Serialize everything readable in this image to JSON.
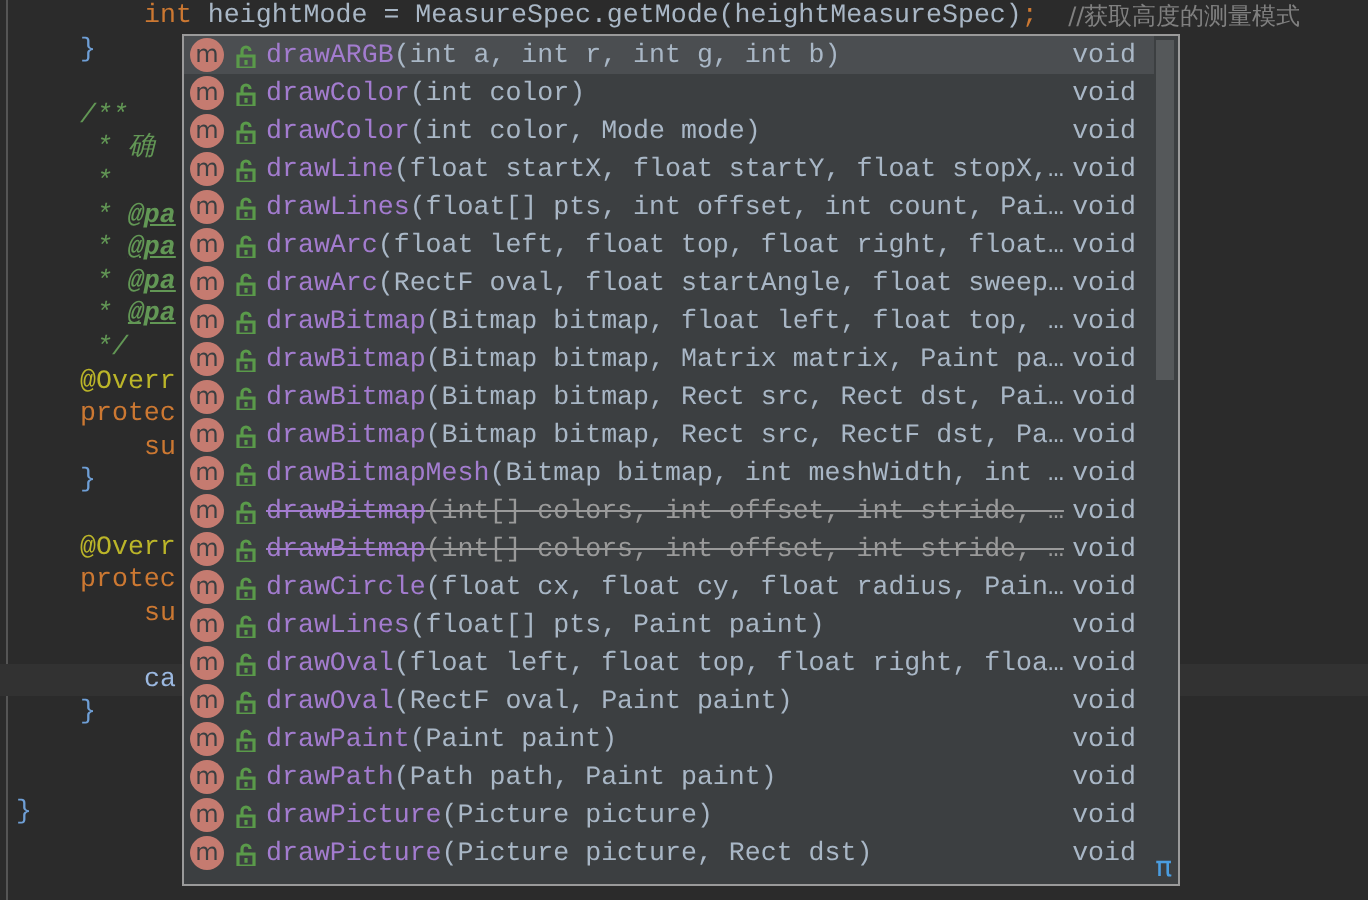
{
  "editor": {
    "lines": [
      {
        "kind": "block",
        "children": [
          {
            "kind": "block",
            "children": [
              {
                "kind": "code",
                "current": false,
                "segments": [
                  {
                    "text": "int",
                    "kind": "keyword"
                  },
                  {
                    "text": " heightMode = MeasureSpec.getMode(heightMeasureSpec)",
                    "kind": "plain"
                  },
                  {
                    "text": ";",
                    "kind": "keyword"
                  },
                  {
                    "text": "    //获取高度的测量模式",
                    "kind": "comment"
                  }
                ]
              }
            ]
          },
          {
            "kind": "code",
            "current": false,
            "segments": [
              {
                "text": "}",
                "kind": "brace"
              }
            ]
          },
          {
            "kind": "blank",
            "current": false
          },
          {
            "kind": "code",
            "current": false,
            "segments": [
              {
                "text": "/**",
                "kind": "doc"
              }
            ]
          },
          {
            "kind": "code",
            "current": false,
            "segments": [
              {
                "text": " * 确",
                "kind": "doc"
              }
            ]
          },
          {
            "kind": "code",
            "current": false,
            "segments": [
              {
                "text": " *",
                "kind": "doc"
              }
            ]
          },
          {
            "kind": "code",
            "current": false,
            "segments": [
              {
                "text": " * ",
                "kind": "doc"
              },
              {
                "text": "@pa",
                "kind": "doctag"
              }
            ]
          },
          {
            "kind": "code",
            "current": false,
            "segments": [
              {
                "text": " * ",
                "kind": "doc"
              },
              {
                "text": "@pa",
                "kind": "doctag"
              }
            ]
          },
          {
            "kind": "code",
            "current": false,
            "segments": [
              {
                "text": " * ",
                "kind": "doc"
              },
              {
                "text": "@pa",
                "kind": "doctag"
              }
            ]
          },
          {
            "kind": "code",
            "current": false,
            "segments": [
              {
                "text": " * ",
                "kind": "doc"
              },
              {
                "text": "@pa",
                "kind": "doctag"
              }
            ]
          },
          {
            "kind": "code",
            "current": false,
            "segments": [
              {
                "text": " */",
                "kind": "doc"
              }
            ]
          },
          {
            "kind": "code",
            "current": false,
            "segments": [
              {
                "text": "@Overr",
                "kind": "annotation"
              }
            ]
          },
          {
            "kind": "code",
            "current": false,
            "segments": [
              {
                "text": "protec",
                "kind": "keyword"
              }
            ]
          },
          {
            "kind": "block",
            "children": [
              {
                "kind": "code",
                "current": false,
                "segments": [
                  {
                    "text": "su",
                    "kind": "keyword"
                  }
                ]
              }
            ]
          },
          {
            "kind": "code",
            "current": false,
            "segments": [
              {
                "text": "}",
                "kind": "brace"
              }
            ]
          },
          {
            "kind": "blank",
            "current": false
          },
          {
            "kind": "code",
            "current": false,
            "segments": [
              {
                "text": "@Overr",
                "kind": "annotation"
              }
            ]
          },
          {
            "kind": "code",
            "current": false,
            "segments": [
              {
                "text": "protec",
                "kind": "keyword"
              }
            ]
          },
          {
            "kind": "block",
            "children": [
              {
                "kind": "code",
                "current": false,
                "segments": [
                  {
                    "text": "su",
                    "kind": "keyword"
                  }
                ]
              },
              {
                "kind": "blank",
                "current": false
              },
              {
                "kind": "code",
                "current": true,
                "segments": [
                  {
                    "text": "ca",
                    "kind": "field"
                  }
                ]
              }
            ]
          },
          {
            "kind": "code",
            "current": false,
            "segments": [
              {
                "text": "}",
                "kind": "brace"
              }
            ]
          },
          {
            "kind": "blank",
            "current": false
          },
          {
            "kind": "blank",
            "current": false
          }
        ]
      },
      {
        "kind": "code",
        "current": false,
        "segments": [
          {
            "text": "}",
            "kind": "brace"
          }
        ]
      }
    ]
  },
  "completion": {
    "items": [
      {
        "badge": "m",
        "name": "drawARGB",
        "params": "(int a, int r, int g, int b)",
        "type": "void",
        "selected": true,
        "deprecated": false
      },
      {
        "badge": "m",
        "name": "drawColor",
        "params": "(int color)",
        "type": "void",
        "selected": false,
        "deprecated": false
      },
      {
        "badge": "m",
        "name": "drawColor",
        "params": "(int color, Mode mode)",
        "type": "void",
        "selected": false,
        "deprecated": false
      },
      {
        "badge": "m",
        "name": "drawLine",
        "params": "(float startX, float startY, float stopX,…",
        "type": "void",
        "selected": false,
        "deprecated": false
      },
      {
        "badge": "m",
        "name": "drawLines",
        "params": "(float[] pts, int offset, int count, Pai…",
        "type": "void",
        "selected": false,
        "deprecated": false
      },
      {
        "badge": "m",
        "name": "drawArc",
        "params": "(float left, float top, float right, float…",
        "type": "void",
        "selected": false,
        "deprecated": false
      },
      {
        "badge": "m",
        "name": "drawArc",
        "params": "(RectF oval, float startAngle, float sweep…",
        "type": "void",
        "selected": false,
        "deprecated": false
      },
      {
        "badge": "m",
        "name": "drawBitmap",
        "params": "(Bitmap bitmap, float left, float top, …",
        "type": "void",
        "selected": false,
        "deprecated": false
      },
      {
        "badge": "m",
        "name": "drawBitmap",
        "params": "(Bitmap bitmap, Matrix matrix, Paint pa…",
        "type": "void",
        "selected": false,
        "deprecated": false
      },
      {
        "badge": "m",
        "name": "drawBitmap",
        "params": "(Bitmap bitmap, Rect src, Rect dst, Pai…",
        "type": "void",
        "selected": false,
        "deprecated": false
      },
      {
        "badge": "m",
        "name": "drawBitmap",
        "params": "(Bitmap bitmap, Rect src, RectF dst, Pa…",
        "type": "void",
        "selected": false,
        "deprecated": false
      },
      {
        "badge": "m",
        "name": "drawBitmapMesh",
        "params": "(Bitmap bitmap, int meshWidth, int …",
        "type": "void",
        "selected": false,
        "deprecated": false
      },
      {
        "badge": "m",
        "name": "drawBitmap",
        "params": "(int[] colors, int offset, int stride, …",
        "type": "void",
        "selected": false,
        "deprecated": true
      },
      {
        "badge": "m",
        "name": "drawBitmap",
        "params": "(int[] colors, int offset, int stride, …",
        "type": "void",
        "selected": false,
        "deprecated": true
      },
      {
        "badge": "m",
        "name": "drawCircle",
        "params": "(float cx, float cy, float radius, Pain…",
        "type": "void",
        "selected": false,
        "deprecated": false
      },
      {
        "badge": "m",
        "name": "drawLines",
        "params": "(float[] pts, Paint paint)",
        "type": "void",
        "selected": false,
        "deprecated": false
      },
      {
        "badge": "m",
        "name": "drawOval",
        "params": "(float left, float top, float right, floa…",
        "type": "void",
        "selected": false,
        "deprecated": false
      },
      {
        "badge": "m",
        "name": "drawOval",
        "params": "(RectF oval, Paint paint)",
        "type": "void",
        "selected": false,
        "deprecated": false
      },
      {
        "badge": "m",
        "name": "drawPaint",
        "params": "(Paint paint)",
        "type": "void",
        "selected": false,
        "deprecated": false
      },
      {
        "badge": "m",
        "name": "drawPath",
        "params": "(Path path, Paint paint)",
        "type": "void",
        "selected": false,
        "deprecated": false
      },
      {
        "badge": "m",
        "name": "drawPicture",
        "params": "(Picture picture)",
        "type": "void",
        "selected": false,
        "deprecated": false
      },
      {
        "badge": "m",
        "name": "drawPicture",
        "params": "(Picture picture, Rect dst)",
        "type": "void",
        "selected": false,
        "deprecated": false
      }
    ],
    "footer_symbol": "π"
  }
}
